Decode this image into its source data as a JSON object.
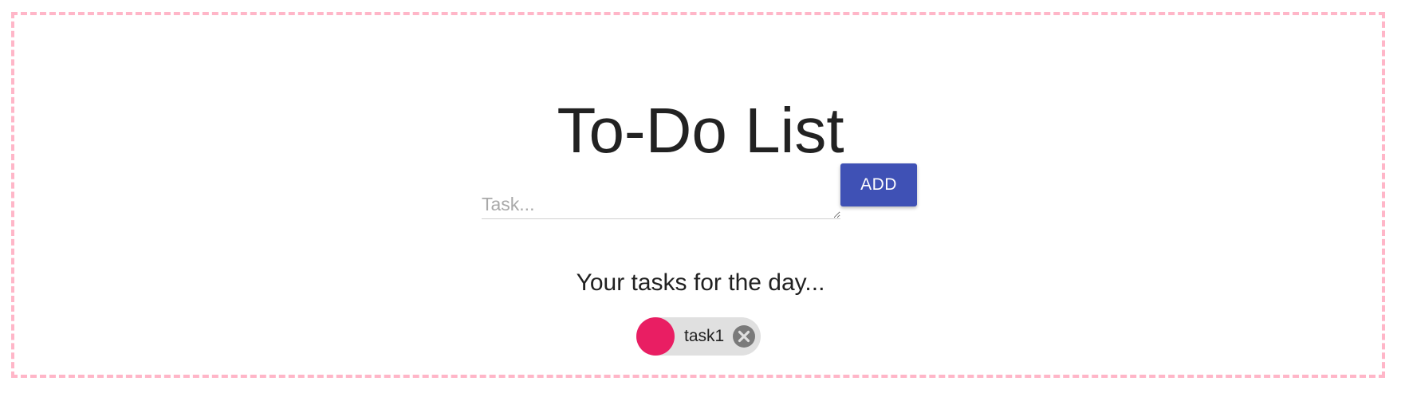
{
  "page": {
    "title": "To-Do List"
  },
  "form": {
    "task_input": {
      "value": "",
      "placeholder": "Task..."
    },
    "add_label": "ADD"
  },
  "tasks_heading": "Your tasks for the day...",
  "tasks": [
    {
      "label": "task1"
    }
  ],
  "icons": {
    "delete": "close-circle-icon"
  },
  "colors": {
    "frame_border": "#ffb6c8",
    "add_button": "#3f51b5",
    "chip_avatar": "#e91e63",
    "chip_background": "#e0e0e0",
    "chip_delete": "#7a7a7a"
  }
}
